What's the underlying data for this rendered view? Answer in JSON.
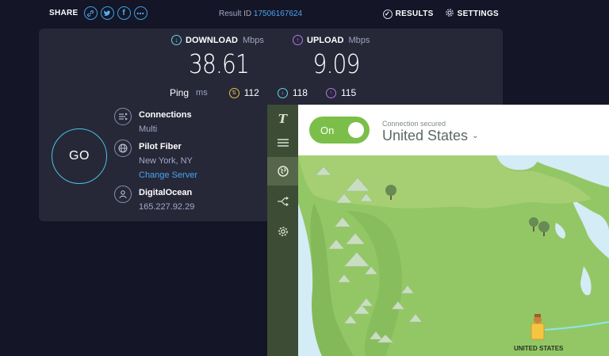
{
  "topbar": {
    "share_label": "SHARE",
    "share_icons": [
      "link-icon",
      "twitter-icon",
      "facebook-icon",
      "more-icon"
    ],
    "result_label": "Result ID",
    "result_id": "17506167624",
    "results_label": "RESULTS",
    "settings_label": "SETTINGS"
  },
  "speed": {
    "download_label": "DOWNLOAD",
    "download_unit": "Mbps",
    "download_value": "38.61",
    "upload_label": "UPLOAD",
    "upload_unit": "Mbps",
    "upload_value": "9.09",
    "ping_label": "Ping",
    "ping_unit": "ms",
    "ping_jitter": "112",
    "ping_download": "118",
    "ping_upload": "115"
  },
  "go_label": "GO",
  "connections": {
    "title": "Connections",
    "value": "Multi"
  },
  "isp": {
    "name": "Pilot Fiber",
    "location": "New York, NY",
    "change_link": "Change Server"
  },
  "host": {
    "name": "DigitalOcean",
    "ip": "165.227.92.29"
  },
  "vpn": {
    "logo": "T",
    "toggle_label": "On",
    "status_label": "Connection secured",
    "country": "United States",
    "map_pin_label": "UNITED STATES",
    "colors": {
      "toggle": "#7bbf4a",
      "sidebar": "#3d4c35",
      "map_land": "#93c766",
      "water": "#d4ecf5"
    }
  },
  "colors": {
    "background": "#141526",
    "panel": "#262838",
    "accent_link": "#4aa3f0",
    "download": "#6ad3e6",
    "upload": "#b774ec"
  }
}
